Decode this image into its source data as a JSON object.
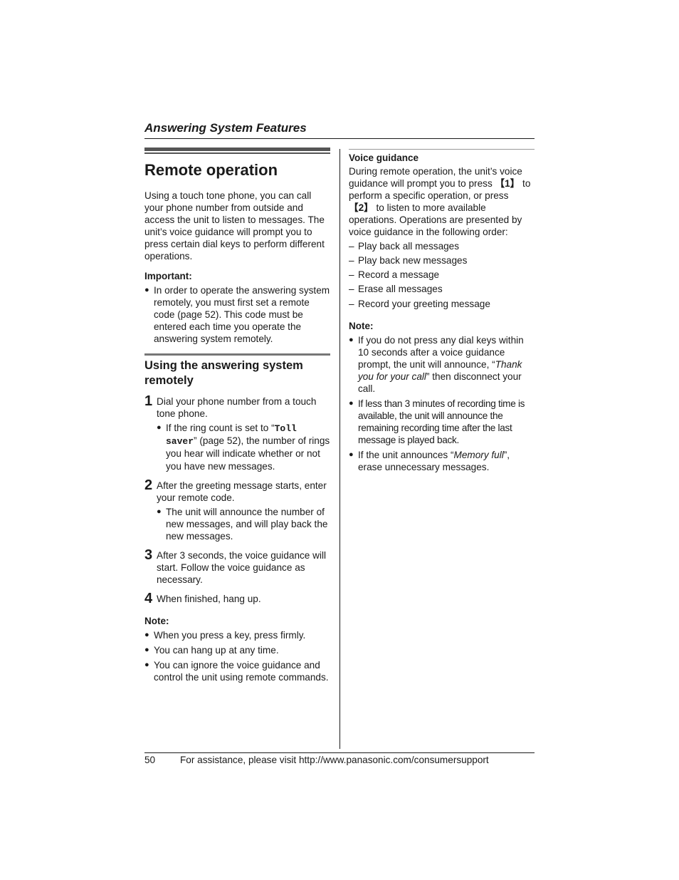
{
  "header": {
    "section_title": "Answering System Features"
  },
  "left": {
    "title": "Remote operation",
    "intro": "Using a touch tone phone, you can call your phone number from outside and access the unit to listen to messages. The unit’s voice guidance will prompt you to press certain dial keys to perform different operations.",
    "important_label": "Important:",
    "important_items": [
      "In order to operate the answering system remotely, you must first set a remote code (page 52). This code must be entered each time you operate the answering system remotely."
    ],
    "subheading": "Using the answering system remotely",
    "steps": [
      {
        "num": "1",
        "text": "Dial your phone number from a touch tone phone.",
        "bullet_pre": "If the ring count is set to “",
        "bullet_mono": "Toll saver",
        "bullet_post": "” (page 52), the number of rings you hear will indicate whether or not you have new messages."
      },
      {
        "num": "2",
        "text": "After the greeting message starts, enter your remote code.",
        "bullet": "The unit will announce the number of new messages, and will play back the new messages."
      },
      {
        "num": "3",
        "text": "After 3 seconds, the voice guidance will start. Follow the voice guidance as necessary."
      },
      {
        "num": "4",
        "text": "When finished, hang up."
      }
    ],
    "note_label": "Note:",
    "notes": [
      "When you press a key, press firmly.",
      "You can hang up at any time.",
      "You can ignore the voice guidance and control the unit using remote commands."
    ]
  },
  "right": {
    "heading": "Voice guidance",
    "para_1": "During remote operation, the unit’s voice guidance will prompt you to press ",
    "key_1": "【1】",
    "para_2": " to perform a specific operation, or press ",
    "key_2": "【2】",
    "para_3": " to listen to more available operations. Operations are presented by voice guidance in the following order:",
    "operations": [
      "Play back all messages",
      "Play back new messages",
      "Record a message",
      "Erase all messages",
      "Record your greeting message"
    ],
    "note_label": "Note:",
    "note_1_pre": "If you do not press any dial keys within 10 seconds after a voice guidance prompt, the unit will announce, “",
    "note_1_italic": "Thank you for your call",
    "note_1_post": "” then disconnect your call.",
    "note_2": "If less than 3 minutes of recording time is available, the unit will announce the remaining recording time after the last message is played back.",
    "note_3_pre": "If the unit announces “",
    "note_3_italic": "Memory full",
    "note_3_post": "”, erase unnecessary messages."
  },
  "footer": {
    "page_number": "50",
    "assistance": "For assistance, please visit http://www.panasonic.com/consumersupport"
  },
  "glyphs": {
    "bullet": "●",
    "dash": "–"
  }
}
